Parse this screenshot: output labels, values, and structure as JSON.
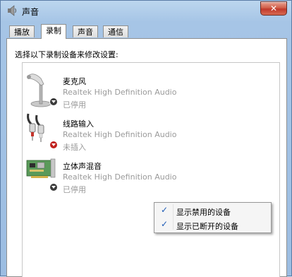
{
  "window": {
    "title": "声音",
    "close_label": "✕"
  },
  "tabs": [
    {
      "label": "播放",
      "selected": false
    },
    {
      "label": "录制",
      "selected": true
    },
    {
      "label": "声音",
      "selected": false
    },
    {
      "label": "通信",
      "selected": false
    }
  ],
  "recording": {
    "instruction": "选择以下录制设备来修改设置:",
    "devices": [
      {
        "name": "麦克风",
        "driver": "Realtek High Definition Audio",
        "status": "已停用",
        "icon": "microphone-icon"
      },
      {
        "name": "线路输入",
        "driver": "Realtek High Definition Audio",
        "status": "未插入",
        "icon": "line-in-icon"
      },
      {
        "name": "立体声混音",
        "driver": "Realtek High Definition Audio",
        "status": "已停用",
        "icon": "sound-card-icon"
      }
    ]
  },
  "context_menu": {
    "items": [
      {
        "label": "显示禁用的设备",
        "checked": true,
        "check": "✓"
      },
      {
        "label": "显示已断开的设备",
        "checked": true,
        "check": "✓"
      }
    ]
  }
}
